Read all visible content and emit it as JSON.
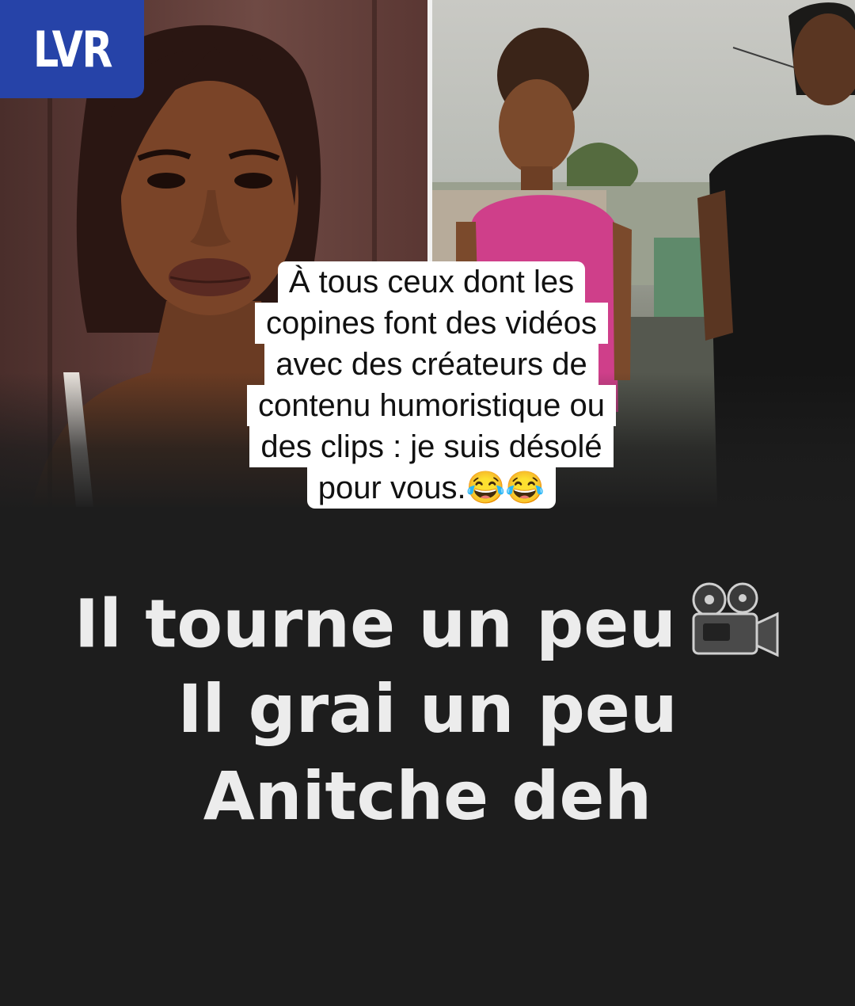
{
  "brand": {
    "logo_text": "LVR",
    "color": "#2643a8"
  },
  "caption": {
    "lines": [
      "À tous ceux dont les",
      "copines font des vidéos",
      "avec des créateurs de",
      "contenu humoristique ou",
      "des clips : je suis désolé",
      "pour vous.😂😂"
    ]
  },
  "main_text": {
    "line1": "Il tourne un peu",
    "line1_icon": "movie-camera-icon",
    "line2": "Il grai un peu",
    "line3": "Anitche deh"
  },
  "colors": {
    "background": "#1d1d1d",
    "text": "#ececec"
  }
}
